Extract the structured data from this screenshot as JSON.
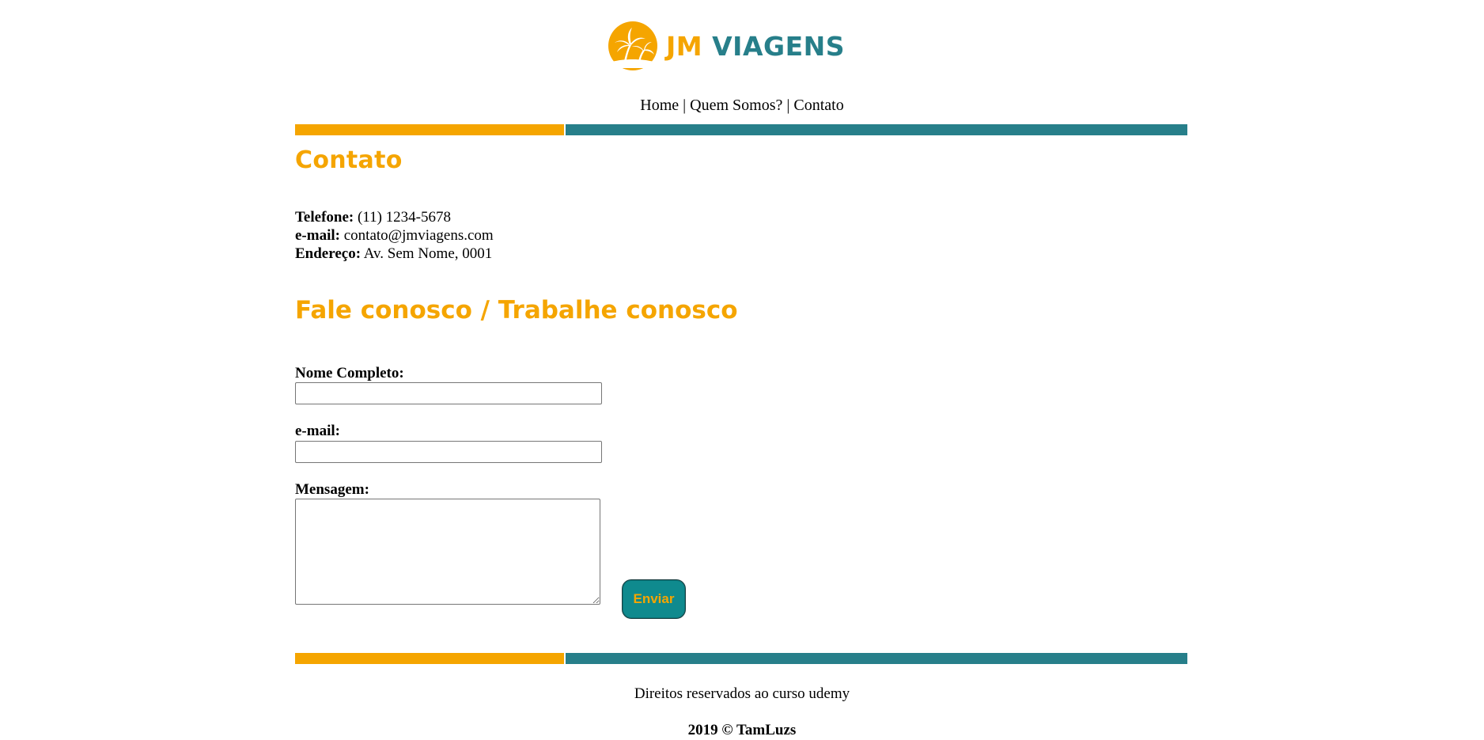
{
  "brand": {
    "name_part1": "JM",
    "name_part2": "VIAGENS",
    "color_orange": "#f5a500",
    "color_teal": "#277f8a",
    "logo_icon": "palm-sun-icon"
  },
  "nav": {
    "items": [
      {
        "label": "Home"
      },
      {
        "label": "Quem Somos?"
      },
      {
        "label": "Contato"
      }
    ],
    "separator": "|"
  },
  "contato": {
    "title": "Contato",
    "telefone_label": "Telefone:",
    "telefone_value": "(11) 1234-5678",
    "email_label": "e-mail:",
    "email_value": "contato@jmviagens.com",
    "endereco_label": "Endereço:",
    "endereco_value": "Av. Sem Nome, 0001"
  },
  "form": {
    "title": "Fale conosco / Trabalhe conosco",
    "nome_label": "Nome Completo:",
    "nome_value": "",
    "email_label": "e-mail:",
    "email_value": "",
    "mensagem_label": "Mensagem:",
    "mensagem_value": "",
    "submit_label": "Enviar",
    "submit_bg": "#0f8a8e"
  },
  "footer": {
    "line1": "Direitos reservados ao curso udemy",
    "line2": "2019 © TamLuzs"
  }
}
